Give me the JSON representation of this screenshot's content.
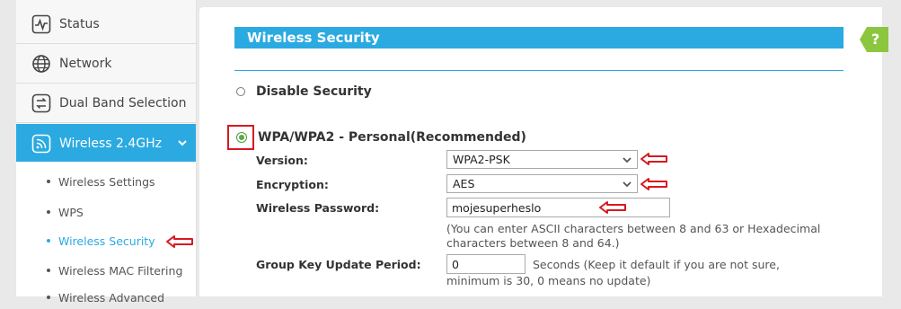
{
  "sidebar": {
    "items": [
      {
        "label": "Status",
        "icon": "pulse-icon"
      },
      {
        "label": "Network",
        "icon": "globe-icon"
      },
      {
        "label": "Dual Band Selection",
        "icon": "swap-icon"
      },
      {
        "label": "Wireless 2.4GHz",
        "icon": "wifi-icon"
      }
    ],
    "submenu": [
      {
        "label": "Wireless Settings"
      },
      {
        "label": "WPS"
      },
      {
        "label": "Wireless Security"
      },
      {
        "label": "Wireless MAC Filtering"
      },
      {
        "label": "Wireless Advanced"
      }
    ]
  },
  "main": {
    "section_title": "Wireless Security",
    "disable_label": "Disable Security",
    "wpa_label": "WPA/WPA2 - Personal(Recommended)",
    "fields": {
      "version_label": "Version:",
      "version_value": "WPA2-PSK",
      "encryption_label": "Encryption:",
      "encryption_value": "AES",
      "password_label": "Wireless Password:",
      "password_value": "mojesuperheslo",
      "password_note_1": "(You can enter ASCII characters between 8 and 63 or Hexadecimal",
      "password_note_2": "characters between 8 and 64.)",
      "group_key_label": "Group Key Update Period:",
      "group_key_value": "0",
      "group_key_note_1": "Seconds (Keep it default if you are not sure,",
      "group_key_note_2": "minimum is 30, 0 means no update)"
    },
    "help_label": "?"
  },
  "colors": {
    "accent": "#2aaae1",
    "help_green": "#8cc63f",
    "annotation_red": "#d71920"
  }
}
